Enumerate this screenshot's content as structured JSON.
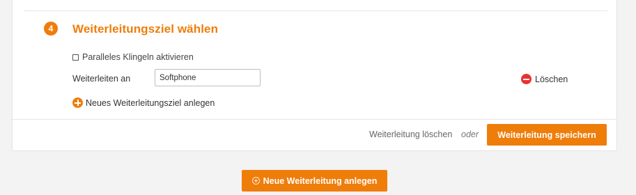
{
  "step": {
    "number": "4",
    "title": "Weiterleitungsziel wählen"
  },
  "options": {
    "parallel_ringing_label": "Paralleles Klingeln aktivieren",
    "parallel_ringing_checked": false
  },
  "forward": {
    "label": "Weiterleiten an",
    "value": "Softphone"
  },
  "actions": {
    "delete_target_label": "Löschen",
    "add_target_label": "Neues Weiterleitungsziel anlegen"
  },
  "footer": {
    "delete_forwarding_label": "Weiterleitung löschen",
    "or_label": "oder",
    "save_label": "Weiterleitung speichern"
  },
  "page_actions": {
    "new_forwarding_label": "Neue Weiterleitung anlegen"
  },
  "colors": {
    "accent": "#ef7d0a",
    "danger": "#e8322e"
  },
  "icons": [
    "plus-circle-icon",
    "minus-circle-icon",
    "plus-outline-icon"
  ]
}
